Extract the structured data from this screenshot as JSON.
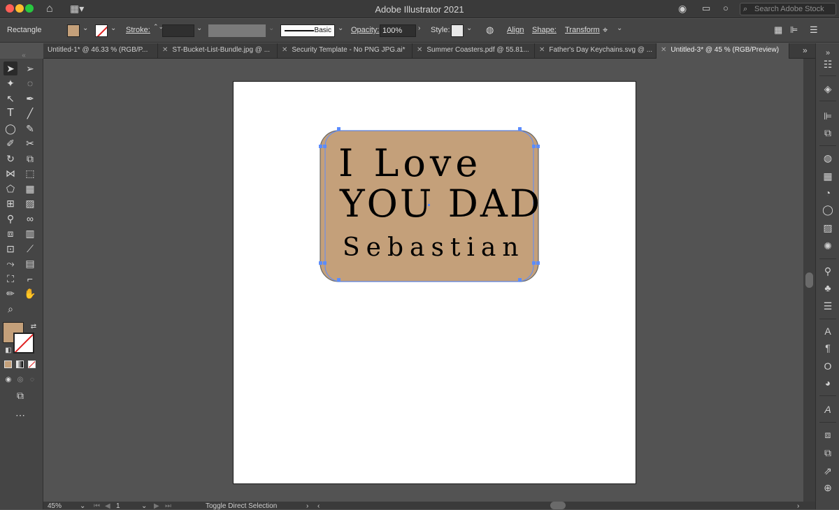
{
  "app": {
    "title": "Adobe Illustrator 2021"
  },
  "search": {
    "placeholder": "Search Adobe Stock"
  },
  "control_bar": {
    "object_type": "Rectangle",
    "stroke_label": "Stroke:",
    "brush_label": "Basic",
    "opacity_label": "Opacity:",
    "opacity_value": "100%",
    "style_label": "Style:",
    "align_label": "Align",
    "shape_label": "Shape:",
    "transform_label": "Transform",
    "fill_color": "#c4a07a"
  },
  "tabs": [
    {
      "label": "Untitled-1* @ 46.33 % (RGB/P..."
    },
    {
      "label": "ST-Bucket-List-Bundle.jpg @ ..."
    },
    {
      "label": "Security Template - No PNG JPG.ai*"
    },
    {
      "label": "Summer Coasters.pdf @ 55.81..."
    },
    {
      "label": "Father's Day Keychains.svg @ ..."
    },
    {
      "label": "Untitled-3* @ 45 % (RGB/Preview)",
      "active": true
    }
  ],
  "artwork": {
    "line1": "I Love",
    "line2": "YOU DAD",
    "line3": "Sebastian",
    "fill": "#c4a07a"
  },
  "status": {
    "zoom": "45%",
    "artboard_number": "1",
    "tool_hint": "Toggle Direct Selection"
  }
}
